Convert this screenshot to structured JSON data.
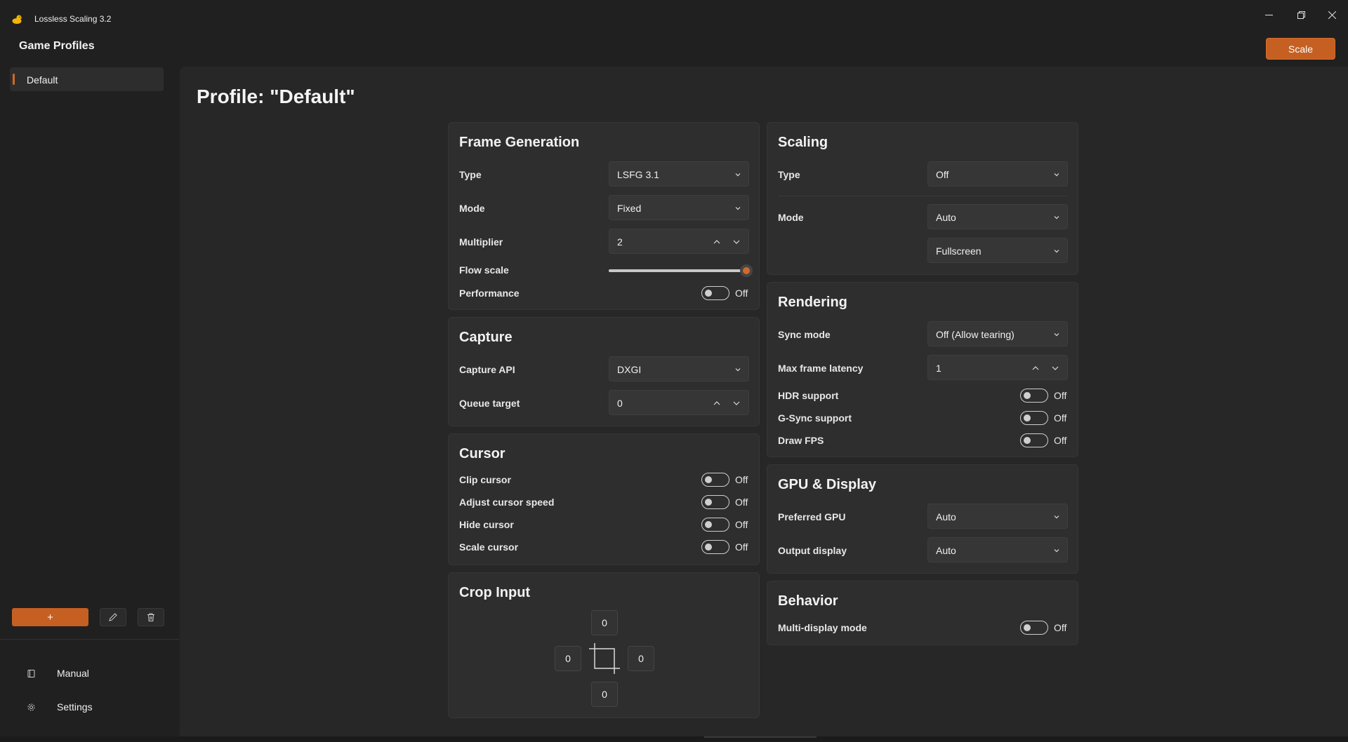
{
  "window": {
    "title": "Lossless Scaling 3.2"
  },
  "header": {
    "heading": "Game Profiles",
    "scale_label": "Scale"
  },
  "sidebar": {
    "profiles": [
      {
        "label": "Default"
      }
    ],
    "add_label": "+",
    "nav": [
      {
        "label": "Manual",
        "icon": "book-icon"
      },
      {
        "label": "Settings",
        "icon": "gear-icon"
      }
    ]
  },
  "main": {
    "title": "Profile: \"Default\"",
    "frame_generation": {
      "title": "Frame Generation",
      "type_label": "Type",
      "type_value": "LSFG 3.1",
      "mode_label": "Mode",
      "mode_value": "Fixed",
      "multiplier_label": "Multiplier",
      "multiplier_value": "2",
      "flow_scale_label": "Flow scale",
      "flow_scale_value": 1.0,
      "performance_label": "Performance",
      "performance_state": "Off"
    },
    "capture": {
      "title": "Capture",
      "api_label": "Capture API",
      "api_value": "DXGI",
      "queue_label": "Queue target",
      "queue_value": "0"
    },
    "cursor": {
      "title": "Cursor",
      "items": [
        {
          "label": "Clip cursor",
          "state": "Off"
        },
        {
          "label": "Adjust cursor speed",
          "state": "Off"
        },
        {
          "label": "Hide cursor",
          "state": "Off"
        },
        {
          "label": "Scale cursor",
          "state": "Off"
        }
      ]
    },
    "crop_input": {
      "title": "Crop Input",
      "top": "0",
      "left": "0",
      "right": "0",
      "bottom": "0"
    },
    "scaling": {
      "title": "Scaling",
      "type_label": "Type",
      "type_value": "Off",
      "mode_label": "Mode",
      "mode_value": "Auto",
      "fit_value": "Fullscreen"
    },
    "rendering": {
      "title": "Rendering",
      "sync_label": "Sync mode",
      "sync_value": "Off (Allow tearing)",
      "latency_label": "Max frame latency",
      "latency_value": "1",
      "items": [
        {
          "label": "HDR support",
          "state": "Off"
        },
        {
          "label": "G-Sync support",
          "state": "Off"
        },
        {
          "label": "Draw FPS",
          "state": "Off"
        }
      ]
    },
    "gpu_display": {
      "title": "GPU & Display",
      "gpu_label": "Preferred GPU",
      "gpu_value": "Auto",
      "output_label": "Output display",
      "output_value": "Auto"
    },
    "behavior": {
      "title": "Behavior",
      "multi_label": "Multi-display mode",
      "multi_state": "Off"
    }
  },
  "colors": {
    "accent": "#c65f22",
    "background": "#202020",
    "card": "#2e2e2e"
  }
}
